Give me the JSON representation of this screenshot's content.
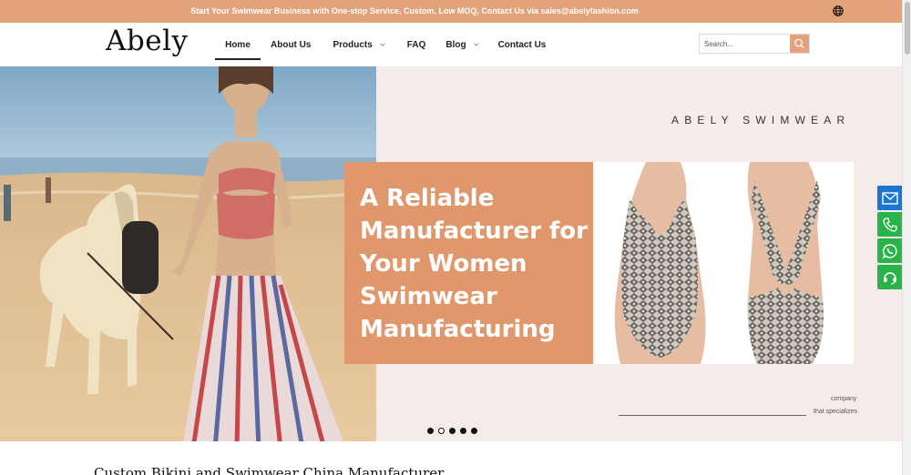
{
  "topbar": {
    "promo": "Start Your Swimwear Business with One-stop Service, Custom, Low MOQ, Contact Us via sales@abelyfashion.com",
    "language_icon": "globe-icon"
  },
  "header": {
    "logo": "Abely",
    "nav": [
      {
        "label": "Home",
        "active": true,
        "dropdown": false
      },
      {
        "label": "About Us",
        "active": false,
        "dropdown": false
      },
      {
        "label": "Products",
        "active": false,
        "dropdown": true
      },
      {
        "label": "FAQ",
        "active": false,
        "dropdown": false
      },
      {
        "label": "Blog",
        "active": false,
        "dropdown": true
      },
      {
        "label": "Contact Us",
        "active": false,
        "dropdown": false
      }
    ],
    "search": {
      "placeholder": "Search...",
      "icon": "search-icon"
    }
  },
  "hero": {
    "brand_tag": "ABELY SWIMWEAR",
    "headline": "A Reliable Manufacturer for Your Women Swimwear Manufacturing",
    "company_text": "company",
    "specializes_text": "that specializes",
    "slider": {
      "total": 5,
      "current": 2
    }
  },
  "side_contacts": [
    {
      "icon": "mail-icon",
      "color": "#1a76d1"
    },
    {
      "icon": "phone-icon",
      "color": "#2bb34b"
    },
    {
      "icon": "whatsapp-icon",
      "color": "#2bb34b"
    },
    {
      "icon": "headset-icon",
      "color": "#2bb34b"
    }
  ],
  "section": {
    "title": "Custom Bikini and Swimwear China Manufacturer"
  },
  "colors": {
    "accent": "#e2a27a",
    "panel": "#e0976b",
    "hero_bg": "#f5ecea"
  }
}
